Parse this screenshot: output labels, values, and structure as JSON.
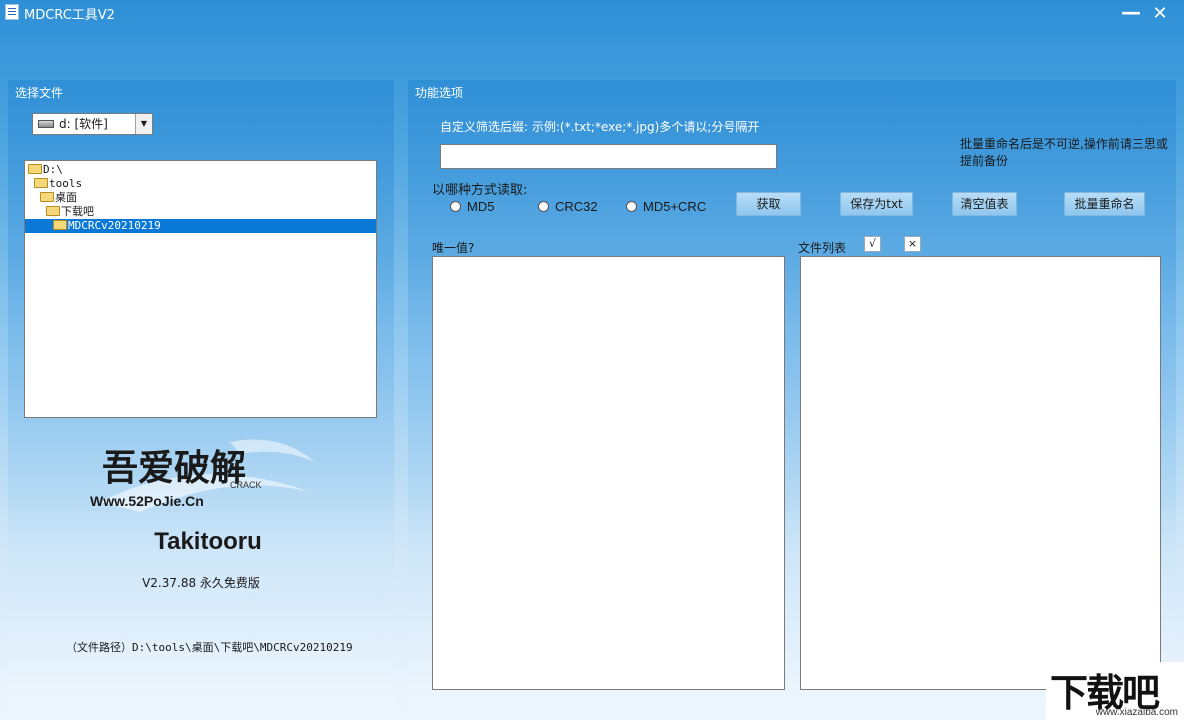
{
  "window": {
    "title": "MDCRC工具V2",
    "minimize": "—",
    "close": "✕"
  },
  "left_panel": {
    "title": "选择文件",
    "drive": "d: [软件]",
    "tree": [
      "D:\\",
      "tools",
      "桌面",
      "下载吧",
      "MDCRCv20210219"
    ],
    "selected_index": 4,
    "logo_main": "吾爱破解",
    "logo_site": "Www.52PoJie.Cn",
    "logo_crack": "CRACK",
    "author": "Takitooru",
    "version": "V2.37.88 永久免费版",
    "file_path": "（文件路径）D:\\tools\\桌面\\下载吧\\MDCRCv20210219"
  },
  "right_panel": {
    "title": "功能选项",
    "filter_label": "自定义筛选后缀: 示例:(*.txt;*exe;*.jpg)多个请以;分号隔开",
    "filter_value": "",
    "warning": "批量重命名后是不可逆,操作前请三思或提前备份",
    "read_label": "以哪种方式读取:",
    "radios": [
      "MD5",
      "CRC32",
      "MD5+CRC"
    ],
    "buttons": {
      "fetch": "获取",
      "save_txt": "保存为txt",
      "clear": "清空值表",
      "batch_rename": "批量重命名"
    },
    "unique_label": "唯一值?",
    "file_list_label": "文件列表",
    "check_btn": "√",
    "x_btn": "×"
  },
  "watermark": {
    "big": "下载吧",
    "small": "www.xiazaiba.com"
  }
}
